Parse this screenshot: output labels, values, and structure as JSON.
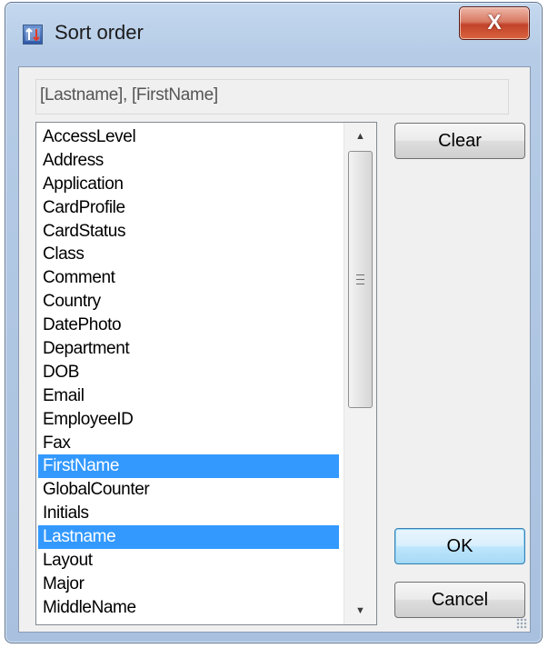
{
  "window": {
    "title": "Sort order",
    "close_label": "X"
  },
  "sort_expression": "[Lastname], [FirstName]",
  "field_list": {
    "items": [
      {
        "label": "AccessLevel",
        "selected": false
      },
      {
        "label": "Address",
        "selected": false
      },
      {
        "label": "Application",
        "selected": false
      },
      {
        "label": "CardProfile",
        "selected": false
      },
      {
        "label": "CardStatus",
        "selected": false
      },
      {
        "label": "Class",
        "selected": false
      },
      {
        "label": "Comment",
        "selected": false
      },
      {
        "label": "Country",
        "selected": false
      },
      {
        "label": "DatePhoto",
        "selected": false
      },
      {
        "label": "Department",
        "selected": false
      },
      {
        "label": "DOB",
        "selected": false
      },
      {
        "label": "Email",
        "selected": false
      },
      {
        "label": "EmployeeID",
        "selected": false
      },
      {
        "label": "Fax",
        "selected": false
      },
      {
        "label": "FirstName",
        "selected": true
      },
      {
        "label": "GlobalCounter",
        "selected": false
      },
      {
        "label": "Initials",
        "selected": false
      },
      {
        "label": "Lastname",
        "selected": true
      },
      {
        "label": "Layout",
        "selected": false
      },
      {
        "label": "Major",
        "selected": false
      },
      {
        "label": "MiddleName",
        "selected": false
      }
    ]
  },
  "buttons": {
    "clear": "Clear",
    "ok": "OK",
    "cancel": "Cancel"
  },
  "colors": {
    "selection": "#3399ff",
    "close_button": "#c2432a",
    "default_button_border": "#3c7fb1"
  },
  "icons": {
    "app": "sort-order-icon",
    "close": "close-icon",
    "scroll_up": "scroll-up-arrow-icon",
    "scroll_down": "scroll-down-arrow-icon",
    "size_grip": "size-grip-icon"
  }
}
